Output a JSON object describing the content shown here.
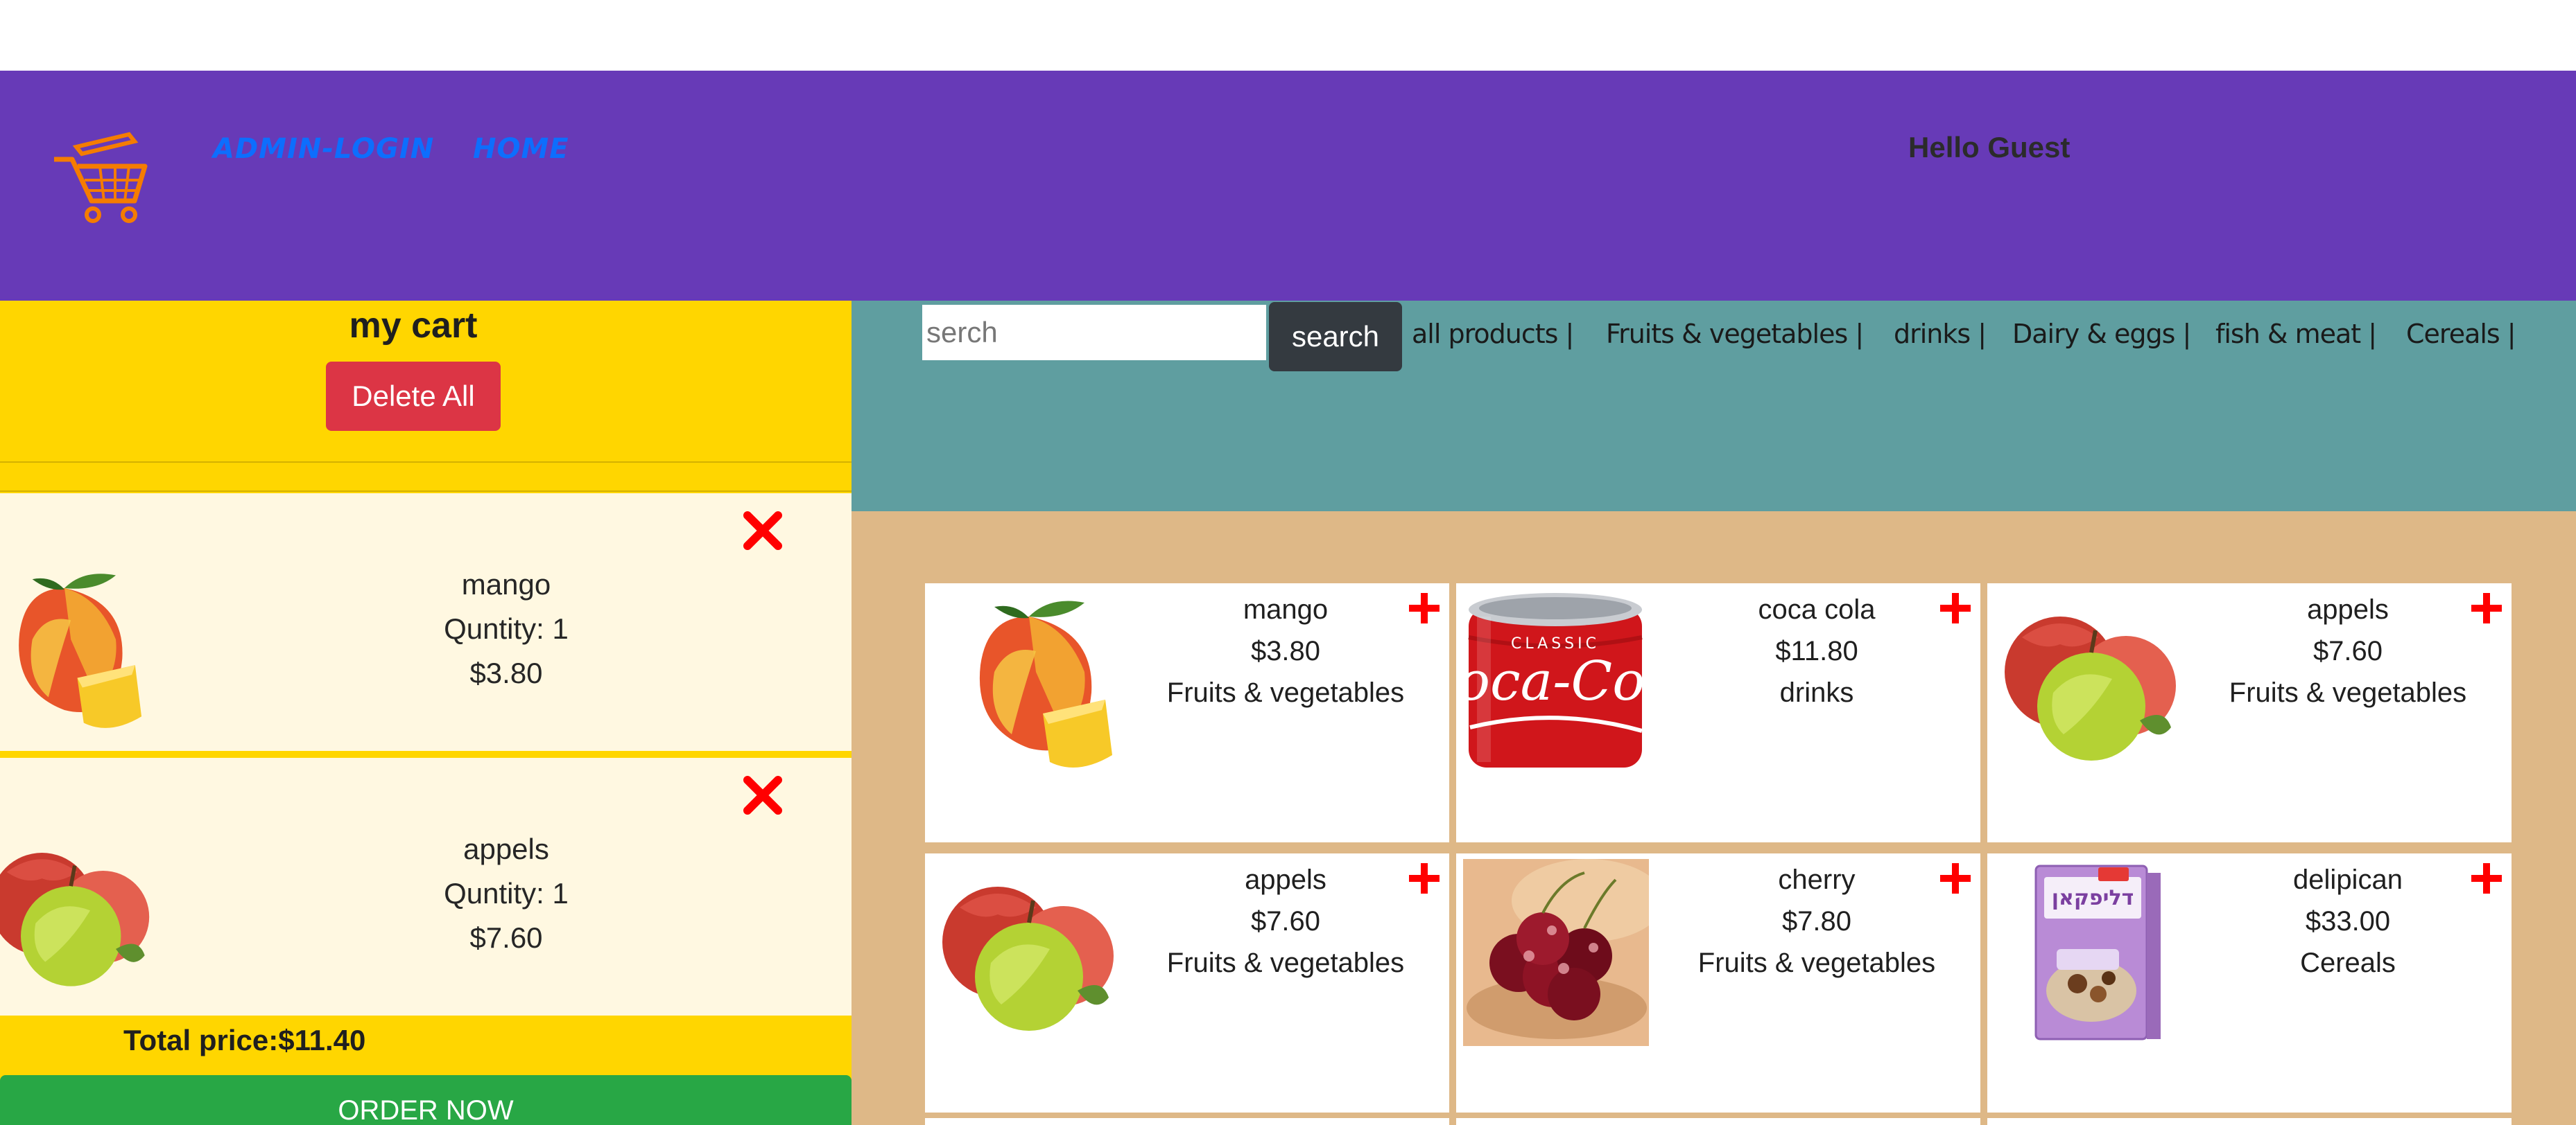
{
  "navbar": {
    "admin_login": "ADMIN-LOGIN",
    "home": "HOME",
    "greeting": "Hello Guest",
    "logo_icon": "cart-icon"
  },
  "colors": {
    "navbar": "#673ab7",
    "cart_panel": "#ffd600",
    "cart_item": "#fff8e1",
    "search_area": "#5f9ea0",
    "products_area": "#deb887",
    "delete_button": "#dc3545",
    "order_button": "#28a745",
    "search_button": "#343a40",
    "icon_red": "#ff0000",
    "cart_orange": "#f57c00"
  },
  "cart": {
    "title": "my cart",
    "delete_all": "Delete All",
    "items": [
      {
        "name": "mango",
        "qty": "Quntity: 1",
        "price": "$3.80",
        "icon": "mango-image"
      },
      {
        "name": "appels",
        "qty": "Quntity: 1",
        "price": "$7.60",
        "icon": "apples-image"
      }
    ],
    "total": "Total price:$11.40",
    "order_now": "ORDER NOW"
  },
  "search": {
    "placeholder": "serch",
    "button": "search"
  },
  "categories": [
    "all products |",
    "Fruits & vegetables |",
    "drinks |",
    "Dairy & eggs |",
    "fish & meat |",
    "Cereals |"
  ],
  "products": [
    {
      "name": "mango",
      "price": "$3.80",
      "category": "Fruits & vegetables",
      "icon": "mango-image"
    },
    {
      "name": "coca cola",
      "price": "$11.80",
      "category": "drinks",
      "icon": "coca-cola-can-image"
    },
    {
      "name": "appels",
      "price": "$7.60",
      "category": "Fruits & vegetables",
      "icon": "apples-image"
    },
    {
      "name": "appels",
      "price": "$7.60",
      "category": "Fruits & vegetables",
      "icon": "apples-image"
    },
    {
      "name": "cherry",
      "price": "$7.80",
      "category": "Fruits & vegetables",
      "icon": "cherries-image"
    },
    {
      "name": "delipican",
      "price": "$33.00",
      "category": "Cereals",
      "icon": "cereal-box-image"
    }
  ],
  "can_text": {
    "top": "CLASSIC",
    "brand": "Coca-Cola"
  },
  "box_text": "דליפקאן"
}
